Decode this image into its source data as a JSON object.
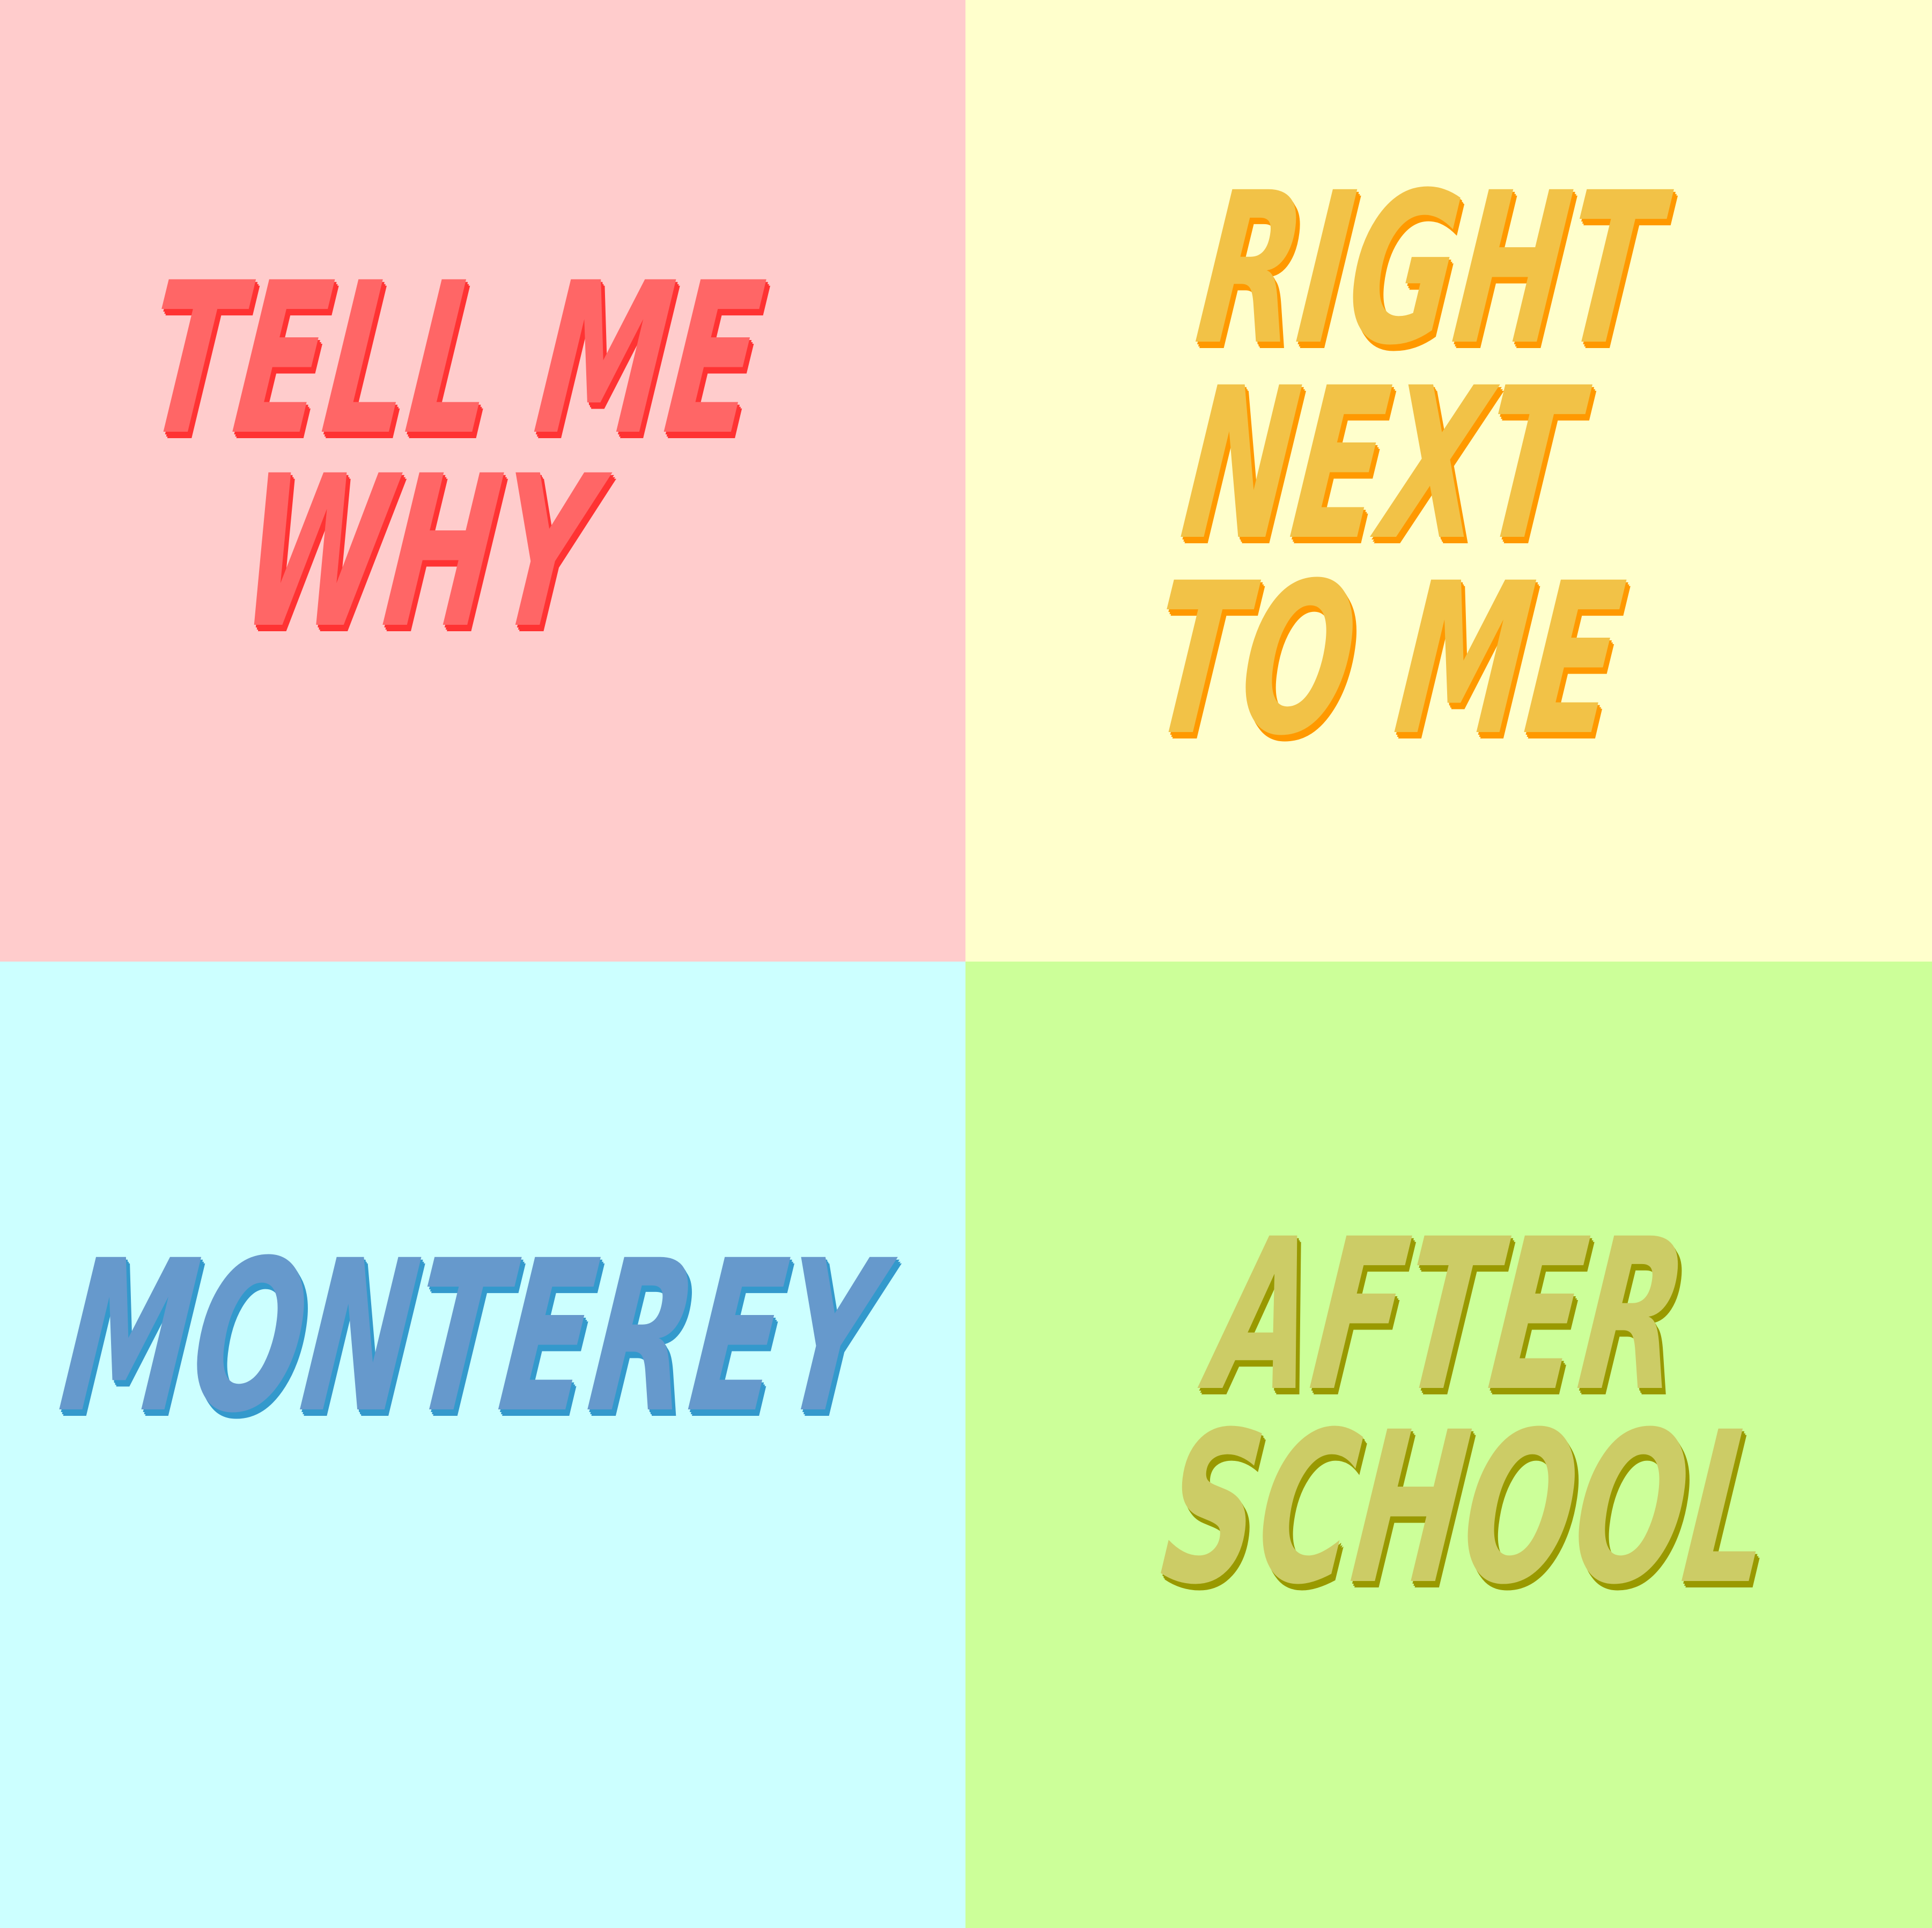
{
  "panels": [
    {
      "id": "tell-me-why",
      "lines": [
        "TELL ME",
        "WHY"
      ],
      "background": "#ffcccc",
      "text_color": "#ff6666",
      "shadow_color": "#ff3333"
    },
    {
      "id": "right-next-to-me",
      "lines": [
        "RIGHT",
        "NEXT",
        "TO ME"
      ],
      "background": "#ffffcc",
      "text_color": "#f2c247",
      "shadow_color": "#ff9900"
    },
    {
      "id": "monterey",
      "lines": [
        "MONTEREY"
      ],
      "background": "#ccffff",
      "text_color": "#6699cc",
      "shadow_color": "#3399cc"
    },
    {
      "id": "after-school",
      "lines": [
        "AFTER",
        "SCHOOL"
      ],
      "background": "#ccff99",
      "text_color": "#cccc66",
      "shadow_color": "#999900"
    }
  ]
}
